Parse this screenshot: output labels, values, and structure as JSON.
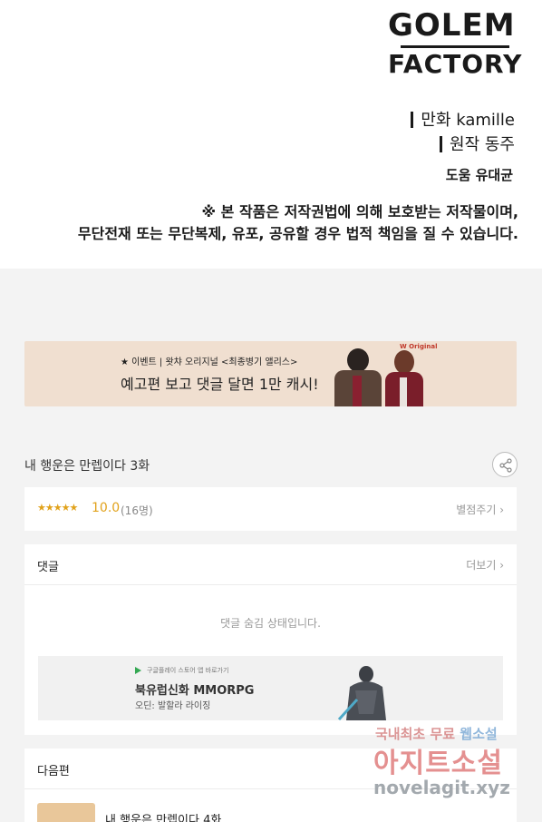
{
  "credits": {
    "logo_line1": "GOLEM",
    "logo_line2": "FACTORY",
    "art": "만화 kamille",
    "story": "원작 동주",
    "assist": "도움 유대균",
    "notice_line1": "※ 본 작품은 저작권법에 의해 보호받는 저작물이며,",
    "notice_line2": "무단전재 또는 무단복제, 유포, 공유할 경우 법적 책임을 질 수 있습니다."
  },
  "banner": {
    "subtitle": "★ 이벤트 | 왓챠 오리지널 <최종병기 앨리스>",
    "title": "예고편 보고 댓글 달면 1만 캐시!",
    "brand": "W Original"
  },
  "episode": {
    "title": "내 행운은 만렙이다 3화"
  },
  "rating": {
    "stars": "★★★★★",
    "score": "10.0",
    "count": "(16명)",
    "rate_link": "별점주기 ›"
  },
  "comments": {
    "label": "댓글",
    "more": "더보기 ›",
    "hidden_message": "댓글 숨김 상태입니다."
  },
  "ad": {
    "store_text": "구글플레이 스토어 앱 바로가기",
    "game": "북유럽신화 MMORPG",
    "developer": "오딘: 발할라 라이징"
  },
  "next": {
    "label": "다음편",
    "title": "내 행운은 만렙이다 4화"
  },
  "watermark": {
    "line1a": "국내최초 무료",
    "line1b": "웹소설",
    "line2": "아지트소설",
    "line3": "novelagit.xyz"
  },
  "colors": {
    "accent_star": "#e1a21b",
    "banner_bg": "#f0dfd0",
    "page_bg": "#f3f3f3"
  }
}
